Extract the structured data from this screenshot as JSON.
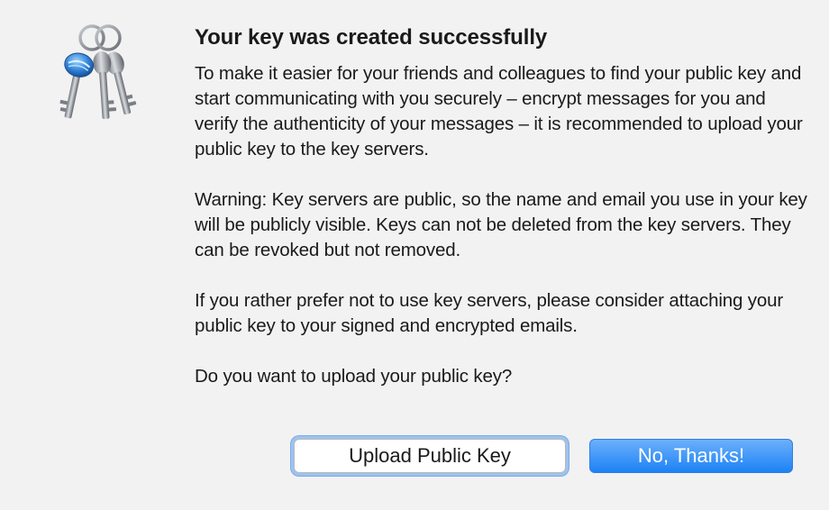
{
  "dialog": {
    "title": "Your key was created successfully",
    "paragraphs": [
      "To make it easier for your friends and colleagues to find your public key and start communicating with you securely – encrypt messages for you and verify the authenticity of your messages – it is recommended to upload your public key to the key servers.",
      "Warning: Key servers are public, so the name and email you use in your key will be publicly visible. Keys can not be deleted from the key servers. They can be revoked but not removed.",
      "If you rather prefer not to use key servers, please consider attaching your public key to your signed and encrypted emails.",
      "Do you want to upload your public key?"
    ],
    "icon": "keychain-icon",
    "buttons": {
      "upload_label": "Upload Public Key",
      "no_thanks_label": "No, Thanks!"
    }
  },
  "colors": {
    "background": "#f2f2f2",
    "primary_button": "#1d82f5",
    "focus_ring": "#9ec3f0"
  }
}
